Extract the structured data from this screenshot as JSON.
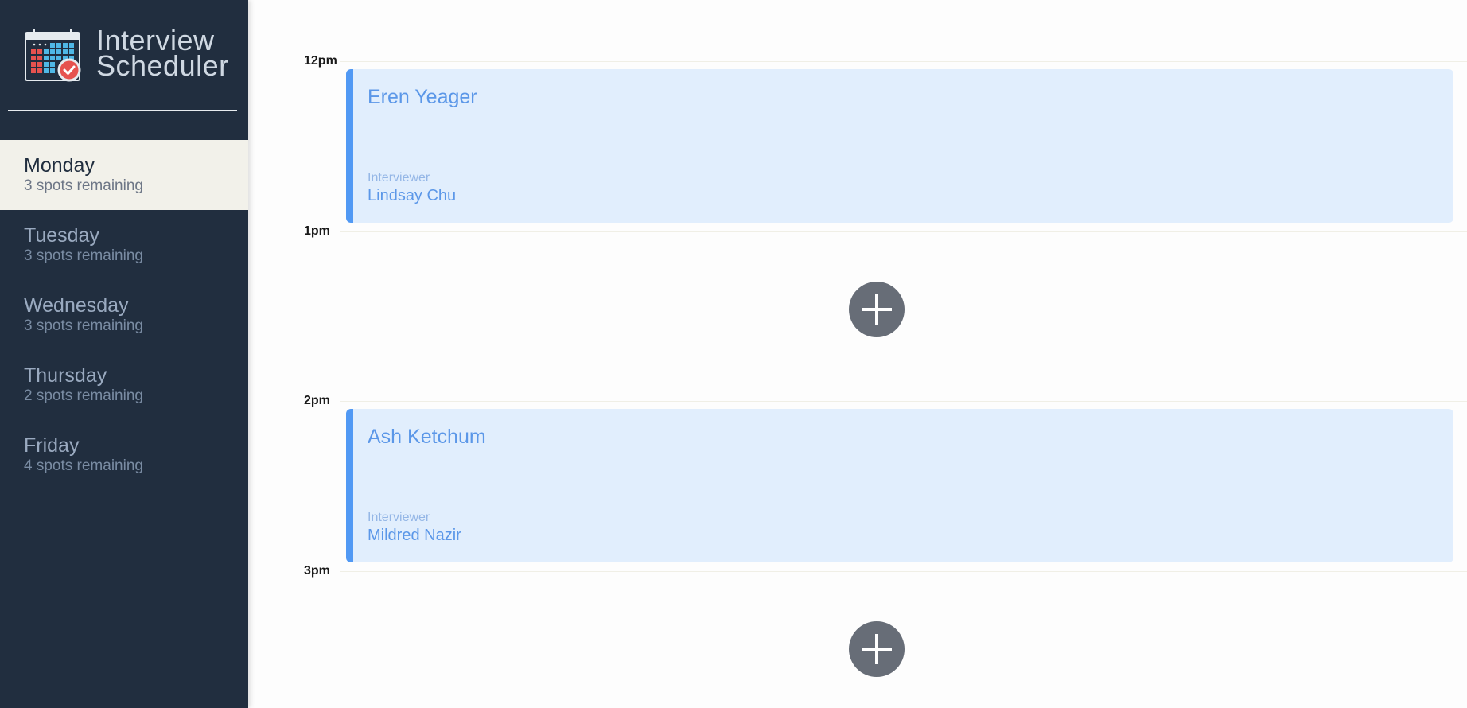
{
  "app": {
    "title_line1": "Interview",
    "title_line2": "Scheduler",
    "logo_icon": "calendar-check-icon"
  },
  "sidebar": {
    "days": [
      {
        "name": "Monday",
        "spots": "3 spots remaining",
        "selected": true
      },
      {
        "name": "Tuesday",
        "spots": "3 spots remaining",
        "selected": false
      },
      {
        "name": "Wednesday",
        "spots": "3 spots remaining",
        "selected": false
      },
      {
        "name": "Thursday",
        "spots": "2 spots remaining",
        "selected": false
      },
      {
        "name": "Friday",
        "spots": "4 spots remaining",
        "selected": false
      }
    ]
  },
  "schedule": {
    "slots": [
      {
        "time": "12pm",
        "student": "Eren Yeager",
        "interviewer_label": "Interviewer",
        "interviewer": "Lindsay Chu"
      },
      {
        "time": "1pm",
        "add_icon": "plus-icon"
      },
      {
        "time": "2pm",
        "student": "Ash Ketchum",
        "interviewer_label": "Interviewer",
        "interviewer": "Mildred Nazir"
      },
      {
        "time": "3pm",
        "add_icon": "plus-icon"
      }
    ]
  },
  "colors": {
    "sidebar_bg": "#212e3f",
    "selected_day_bg": "#f2f1ea",
    "appointment_bg": "#e1eefd",
    "appointment_accent": "#5199f4",
    "add_button": "#676d77"
  }
}
